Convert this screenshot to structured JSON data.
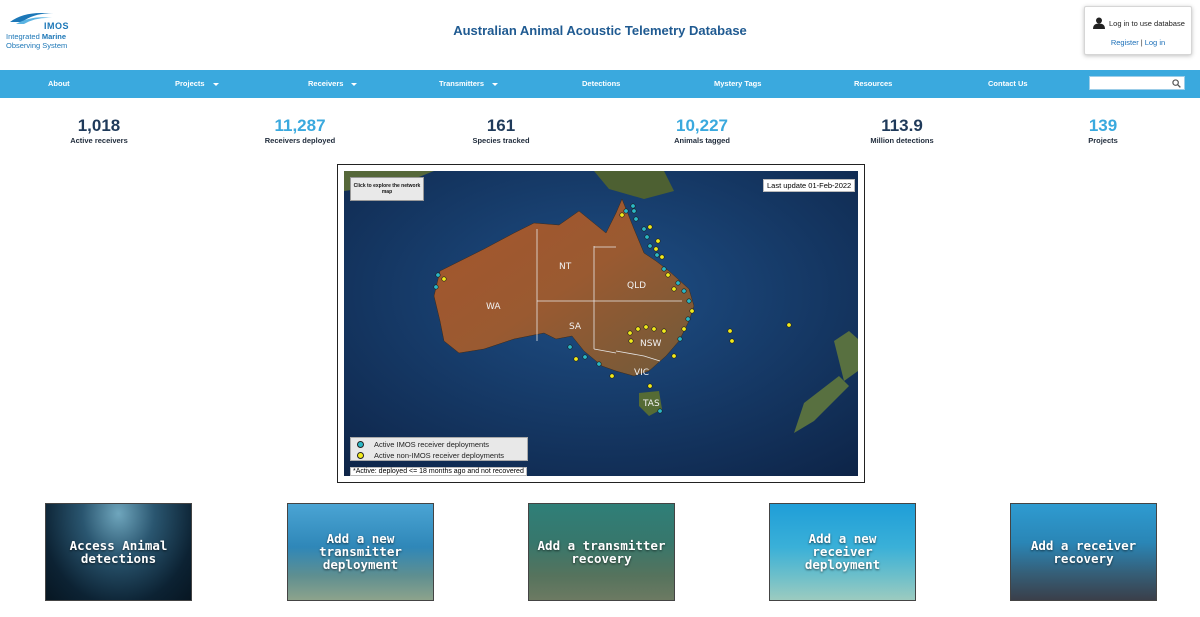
{
  "header": {
    "logo": {
      "brand": "IMOS",
      "line1_plain": "Integrated ",
      "line1_bold": "Marine",
      "line2": "Observing System"
    },
    "site_title": "Australian Animal Acoustic Telemetry Database",
    "login": {
      "prompt": "Log in to use database",
      "register": "Register",
      "separator": "|",
      "login": "Log in",
      "icon": "user-icon"
    }
  },
  "nav": {
    "items": [
      {
        "label": "About",
        "dropdown": false
      },
      {
        "label": "Projects",
        "dropdown": true
      },
      {
        "label": "Receivers",
        "dropdown": true
      },
      {
        "label": "Transmitters",
        "dropdown": true
      },
      {
        "label": "Detections",
        "dropdown": false
      },
      {
        "label": "Mystery Tags",
        "dropdown": false
      },
      {
        "label": "Resources",
        "dropdown": false
      },
      {
        "label": "Contact Us",
        "dropdown": false
      }
    ],
    "search": {
      "value": "",
      "placeholder": "",
      "icon": "search-icon"
    }
  },
  "stats": [
    {
      "value": "1,018",
      "label": "Active receivers",
      "color": "#1f3a5a"
    },
    {
      "value": "11,287",
      "label": "Receivers deployed",
      "color": "#3aa9de"
    },
    {
      "value": "161",
      "label": "Species tracked",
      "color": "#1f3a5a"
    },
    {
      "value": "10,227",
      "label": "Animals tagged",
      "color": "#3aa9de"
    },
    {
      "value": "113.9",
      "label": "Million detections",
      "color": "#1f3a5a"
    },
    {
      "value": "139",
      "label": "Projects",
      "color": "#3aa9de"
    }
  ],
  "map": {
    "explore_button": "Click to explore the network map",
    "last_update": "Last update 01-Feb-2022",
    "regions": [
      "NT",
      "QLD",
      "WA",
      "SA",
      "NSW",
      "VIC",
      "TAS"
    ],
    "legend": [
      {
        "label": "Active IMOS receiver deployments",
        "color": "#2ab8c6"
      },
      {
        "label": "Active non-IMOS receiver deployments",
        "color": "#f2ea1a"
      }
    ],
    "footnote": "*Active: deployed <= 18 months ago and not recovered"
  },
  "tiles": [
    {
      "line1": "Access Animal",
      "line2": "detections",
      "line3": ""
    },
    {
      "line1": "Add a new",
      "line2": "transmitter",
      "line3": "deployment"
    },
    {
      "line1": "Add a transmitter",
      "line2": "recovery",
      "line3": ""
    },
    {
      "line1": "Add a new",
      "line2": "receiver",
      "line3": "deployment"
    },
    {
      "line1": "Add a receiver",
      "line2": "recovery",
      "line3": ""
    }
  ],
  "colors": {
    "nav_bg": "#3aa9de",
    "title": "#1f5a91",
    "link": "#1b6fb8"
  }
}
